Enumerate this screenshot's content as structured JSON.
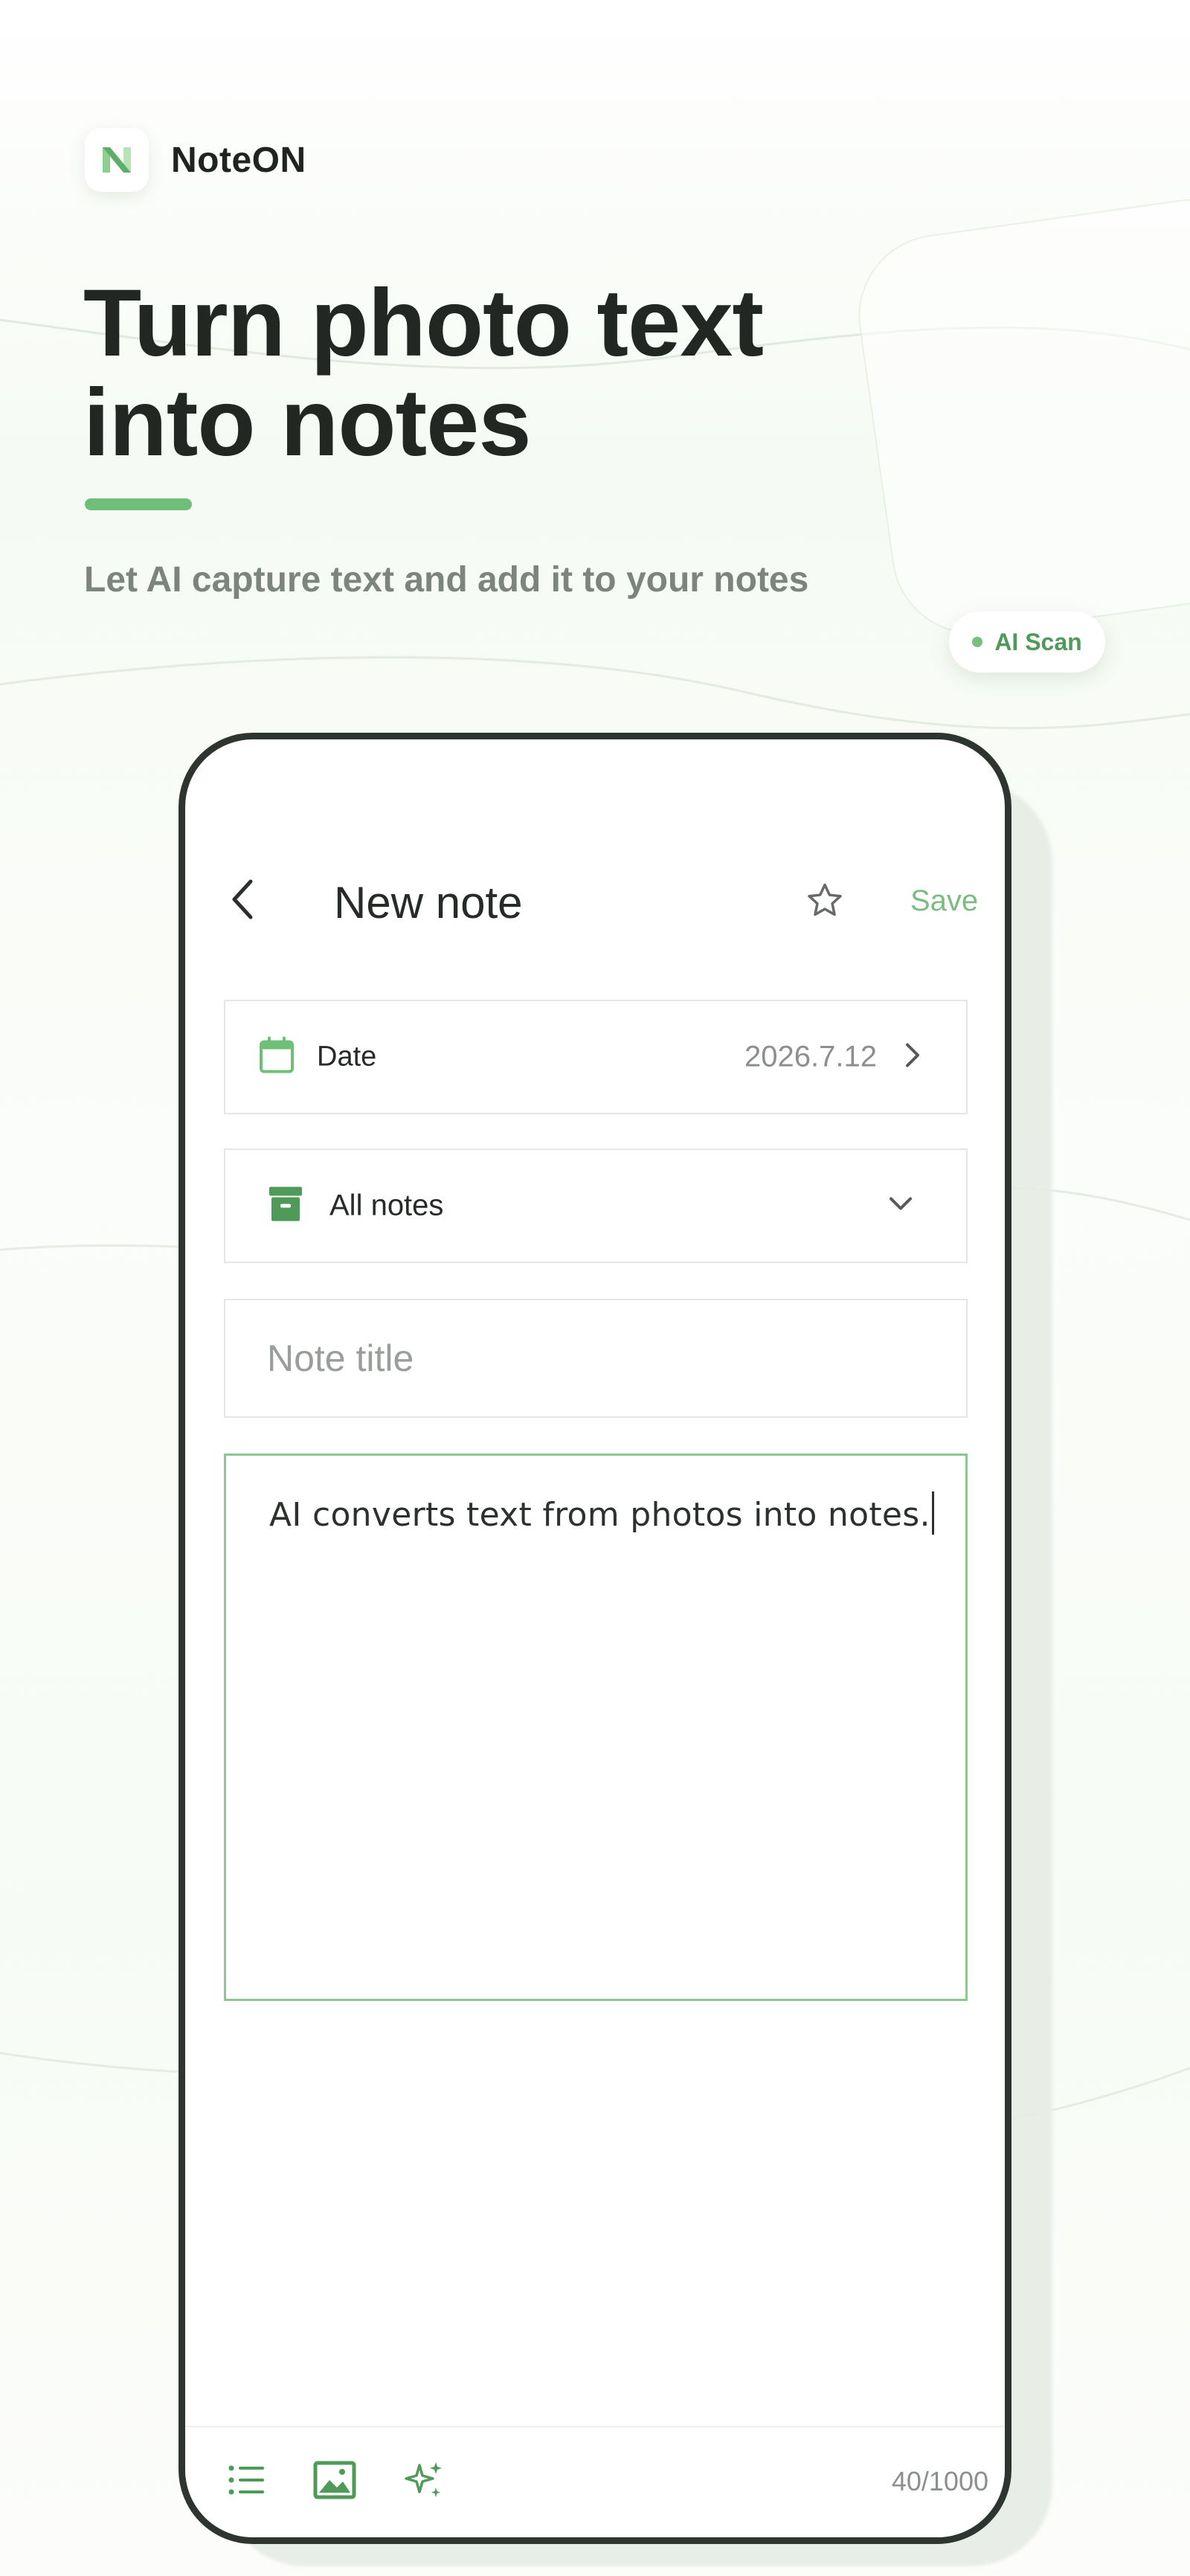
{
  "brand": {
    "name": "NoteON",
    "logo_icon": "noteon-logo-icon",
    "accent_color": "#6fbf78"
  },
  "hero": {
    "title_line1": "Turn photo text",
    "title_line2": "into notes",
    "subtitle": "Let AI capture text and add it to your notes"
  },
  "badge": {
    "label": "AI Scan"
  },
  "nav": {
    "back_icon": "chevron-left-icon",
    "title": "New note",
    "star_icon": "star-outline-icon",
    "save_label": "Save"
  },
  "form": {
    "date": {
      "icon": "calendar-icon",
      "label": "Date",
      "value": "2026.7.12"
    },
    "folder": {
      "icon": "archive-box-icon",
      "label": "All notes"
    },
    "title_placeholder": "Note title",
    "body_text": "AI converts text from photos into notes."
  },
  "toolbar": {
    "list_icon": "list-icon",
    "image_icon": "image-icon",
    "ai_icon": "sparkle-icon",
    "counter": "40/1000"
  }
}
